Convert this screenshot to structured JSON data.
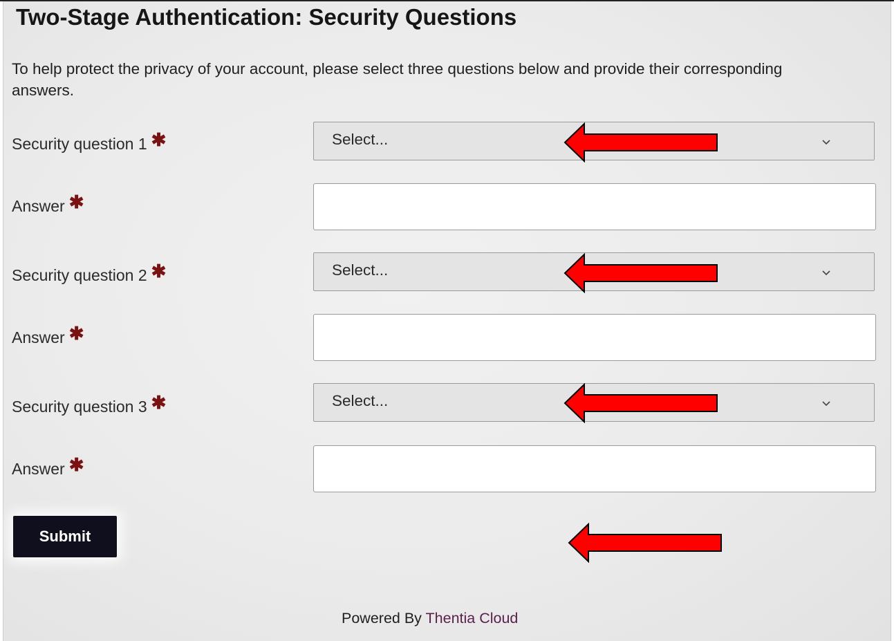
{
  "page": {
    "title": "Two-Stage Authentication: Security Questions",
    "intro": "To help protect the privacy of your account, please select three questions below and provide their corresponding answers."
  },
  "form": {
    "required_marker": "✱",
    "questions": [
      {
        "label": "Security question 1",
        "select_value": "Select...",
        "answer_label": "Answer",
        "answer_value": ""
      },
      {
        "label": "Security question 2",
        "select_value": "Select...",
        "answer_label": "Answer",
        "answer_value": ""
      },
      {
        "label": "Security question 3",
        "select_value": "Select...",
        "answer_label": "Answer",
        "answer_value": ""
      }
    ],
    "submit_label": "Submit"
  },
  "footer": {
    "powered_by": "Powered By",
    "brand": "Thentia Cloud"
  },
  "icons": {
    "select_caret": "chevron-down-icon",
    "annotation": "red-arrow-icon"
  },
  "colors": {
    "submit_bg": "#0f0f1e",
    "required": "#7a1212",
    "brand": "#5a1f4a",
    "annotation_arrow": "#ff0000"
  }
}
